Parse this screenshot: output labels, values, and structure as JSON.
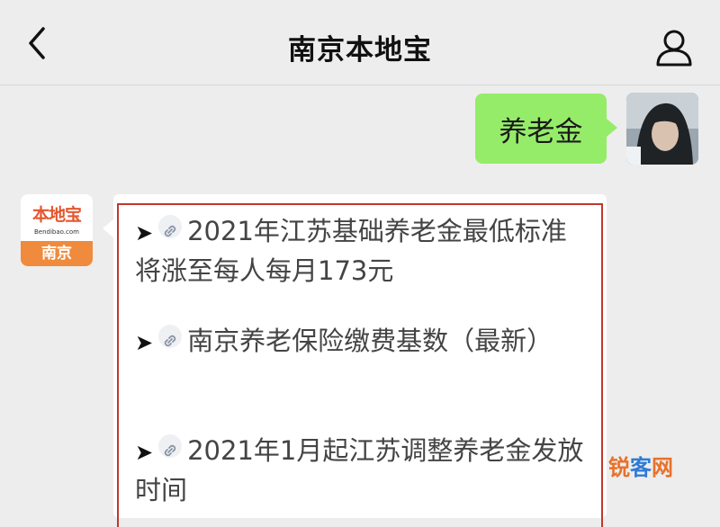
{
  "header": {
    "title": "南京本地宝"
  },
  "messages": {
    "sent": {
      "text": "养老金"
    },
    "received": {
      "avatar": {
        "brand": "本地宝",
        "url": "Bendibao.com",
        "city": "南京"
      },
      "links": [
        {
          "text": "2021年江苏基础养老金最低标准将涨至每人每月173元"
        },
        {
          "text": "南京养老保险缴费基数（最新）"
        },
        {
          "text": "2021年1月起江苏调整养老金发放时间"
        }
      ]
    }
  },
  "watermark": {
    "part1": "锐",
    "part2": "客",
    "part3": "网"
  },
  "colors": {
    "sent_bubble": "#95ec69",
    "frame": "#c0392b",
    "brand_orange": "#f08a3c"
  }
}
